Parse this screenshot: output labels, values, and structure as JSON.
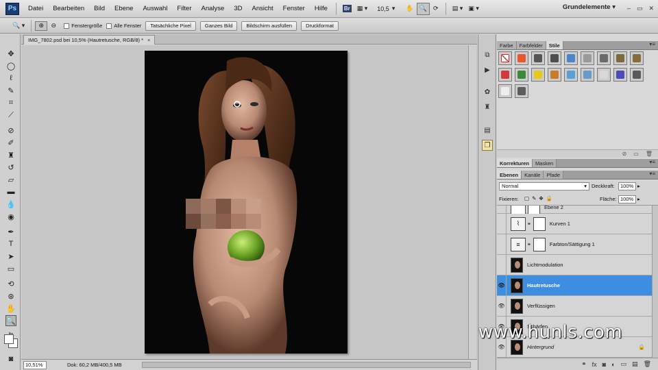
{
  "menubar": {
    "logo": "Ps",
    "items": [
      "Datei",
      "Bearbeiten",
      "Bild",
      "Ebene",
      "Auswahl",
      "Filter",
      "Analyse",
      "3D",
      "Ansicht",
      "Fenster",
      "Hilfe"
    ],
    "bridge_badge": "Br",
    "zoom_value": "10,5",
    "workspace": "Grundelemente",
    "workspace_arrow": "▾",
    "window_controls": [
      "–",
      "▭",
      "✕"
    ]
  },
  "options": {
    "checks": [
      "Fenstergröße",
      "Alle Fenster"
    ],
    "buttons": [
      "Tatsächliche Pixel",
      "Ganzes Bild",
      "Bildschirm ausfüllen",
      "Druckformat"
    ]
  },
  "document": {
    "tab_title": "IMG_7802.psd bei 10,5% (Hautretusche, RGB/8) *",
    "close": "×"
  },
  "status": {
    "zoom": "10,51%",
    "doc": "Dok: 60,2 MB/400,5 MB"
  },
  "panels": {
    "top_tabs": [
      "Farbe",
      "Farbfelder",
      "Stile"
    ],
    "top_active": 2,
    "mid_tabs": [
      "Korrekturen",
      "Masken"
    ],
    "layer_tabs": [
      "Ebenen",
      "Kanäle",
      "Pfade"
    ],
    "blend_mode": "Normal",
    "opacity_label": "Deckkraft:",
    "opacity": "100%",
    "lock_label": "Fixieren:",
    "fill_label": "Fläche:",
    "fill": "100%",
    "menu": "▾≡"
  },
  "styles_colors": [
    [
      "#ffffff",
      "#e8562e",
      "#555555",
      "#4d4d4d",
      "#4a86c8",
      "#9a9a9a",
      "#6b6b6b",
      "#7d6a3a",
      "#8a6b3a"
    ],
    [
      "#d23a3a",
      "#3a8a3a",
      "#e8c81a",
      "#c97a2a",
      "#5aa0d8",
      "#6a9ac8",
      "#d8d8d8",
      "#4a4ab8",
      "#5a5a5a"
    ],
    [
      "#eeeeee",
      "#5d5d5d"
    ]
  ],
  "layers": [
    {
      "name": "Ebene 2",
      "visible": false,
      "kind": "mask",
      "selected": false
    },
    {
      "name": "Kurven 1",
      "visible": false,
      "kind": "adjust",
      "icon": "⌇",
      "selected": false
    },
    {
      "name": "Farbton/Sättigung 1",
      "visible": false,
      "kind": "adjust",
      "icon": "≡",
      "selected": false
    },
    {
      "name": "Lichtmodulation",
      "visible": false,
      "kind": "photo",
      "selected": false
    },
    {
      "name": "Hautretusche",
      "visible": true,
      "kind": "photo",
      "selected": true
    },
    {
      "name": "Verflüssigen",
      "visible": true,
      "kind": "photo",
      "selected": false
    },
    {
      "name": "Schärfen",
      "visible": true,
      "kind": "photo",
      "selected": false
    },
    {
      "name": "Hintergrund",
      "visible": true,
      "kind": "photo",
      "selected": false
    }
  ],
  "layers_footer_icons": [
    "⚭",
    "fx",
    "◙",
    "◐",
    "▭",
    "▤",
    "🗑"
  ],
  "watermark": "www.hunls.com"
}
